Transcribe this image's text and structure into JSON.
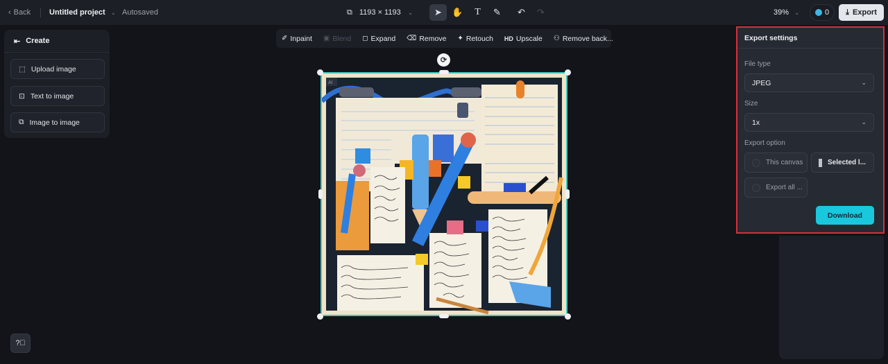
{
  "topbar": {
    "back_label": "Back",
    "project_name": "Untitled project",
    "autosave_status": "Autosaved",
    "canvas_size": "1193 × 1193",
    "tools": [
      {
        "name": "select",
        "icon": "cursor-icon",
        "active": true
      },
      {
        "name": "hand",
        "icon": "hand-icon",
        "active": false
      },
      {
        "name": "text",
        "icon": "text-icon",
        "active": false
      },
      {
        "name": "brush",
        "icon": "brush-icon",
        "active": false
      }
    ],
    "undo_icon": "undo-icon",
    "redo_icon": "redo-icon",
    "zoom_level": "39%",
    "credits": "0",
    "export_label": "Export"
  },
  "left_panel": {
    "title": "Create",
    "items": [
      {
        "label": "Upload image",
        "icon": "upload-image-icon"
      },
      {
        "label": "Text to image",
        "icon": "text-to-image-icon"
      },
      {
        "label": "Image to image",
        "icon": "image-to-image-icon"
      }
    ]
  },
  "edit_toolbar": {
    "items": [
      {
        "label": "Inpaint",
        "icon": "inpaint-icon",
        "disabled": false
      },
      {
        "label": "Blend",
        "icon": "blend-icon",
        "disabled": true
      },
      {
        "label": "Expand",
        "icon": "expand-icon",
        "disabled": false
      },
      {
        "label": "Remove",
        "icon": "eraser-icon",
        "disabled": false
      },
      {
        "label": "Retouch",
        "icon": "magic-wand-icon",
        "disabled": false
      },
      {
        "label": "Upscale",
        "icon": "hd-icon",
        "icon_text": "HD",
        "disabled": false
      },
      {
        "label": "Remove back...",
        "icon": "remove-background-icon",
        "disabled": false
      }
    ]
  },
  "canvas": {
    "image_description": "AI-generated collage of notes, pencils and ribbons",
    "ai_badge": "AI"
  },
  "export_settings": {
    "title": "Export settings",
    "file_type_label": "File type",
    "file_type_value": "JPEG",
    "size_label": "Size",
    "size_value": "1x",
    "export_option_label": "Export option",
    "options": [
      {
        "label": "This canvas",
        "selected": false
      },
      {
        "label": "Selected l...",
        "selected": true
      },
      {
        "label": "Export all ...",
        "selected": false
      }
    ],
    "download_label": "Download"
  },
  "colors": {
    "accent": "#19c8dd",
    "selection": "#3fc9c0",
    "highlight_border": "#d4303c"
  }
}
